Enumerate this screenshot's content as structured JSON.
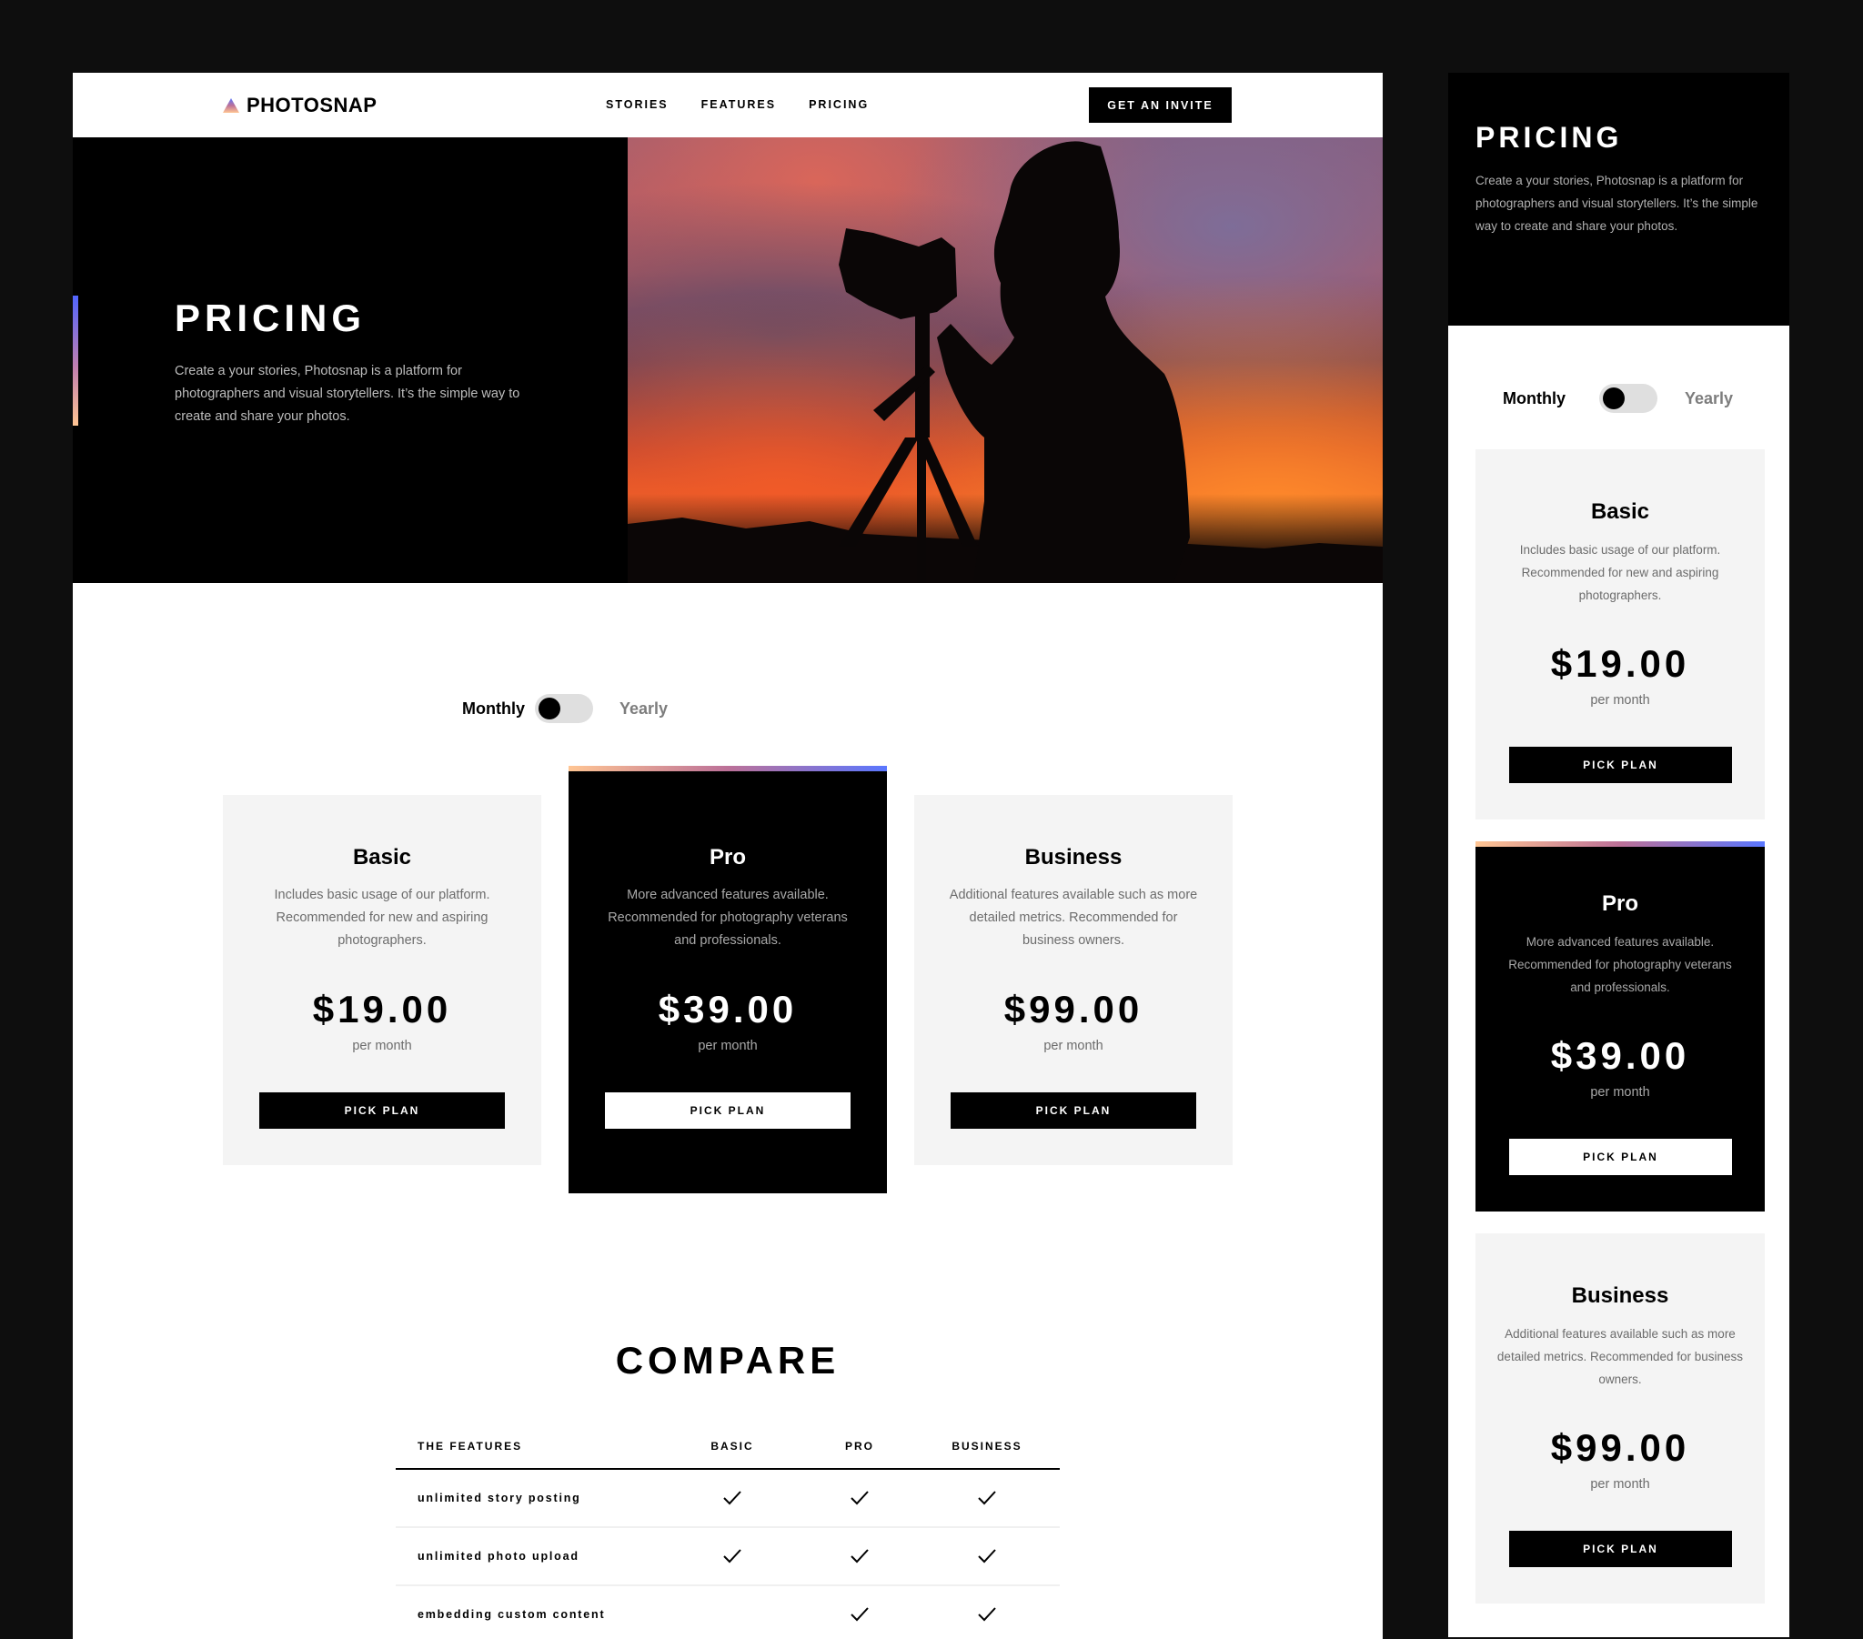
{
  "brand": {
    "name": "PHOTOSNAP",
    "logo_icon": "triangle-logo-icon"
  },
  "nav": {
    "links": [
      "STORIES",
      "FEATURES",
      "PRICING"
    ],
    "cta": "GET AN INVITE"
  },
  "hero": {
    "title": "PRICING",
    "text": "Create a your stories, Photosnap is a platform for photographers and visual storytellers. It’s the simple way to create and share your photos.",
    "image": "photographer-silhouette-sunset"
  },
  "billing": {
    "monthly": "Monthly",
    "yearly": "Yearly",
    "selected": "Monthly"
  },
  "plans": [
    {
      "name": "Basic",
      "desc": "Includes basic usage of our platform. Recommended for new and aspiring photographers.",
      "price": "$19.00",
      "period": "per month",
      "cta": "PICK PLAN",
      "featured": false
    },
    {
      "name": "Pro",
      "desc": "More advanced features available. Recommended for photography veterans and professionals.",
      "price": "$39.00",
      "period": "per month",
      "cta": "PICK PLAN",
      "featured": true
    },
    {
      "name": "Business",
      "desc": "Additional features available such as more detailed metrics. Recommended for business owners.",
      "price": "$99.00",
      "period": "per month",
      "cta": "PICK PLAN",
      "featured": false
    }
  ],
  "compare": {
    "title": "COMPARE",
    "headers": [
      "THE FEATURES",
      "BASIC",
      "PRO",
      "BUSINESS"
    ],
    "rows": [
      {
        "feature": "unlimited story posting",
        "basic": true,
        "pro": true,
        "business": true
      },
      {
        "feature": "unlimited photo upload",
        "basic": true,
        "pro": true,
        "business": true
      },
      {
        "feature": "embedding custom content",
        "basic": false,
        "pro": true,
        "business": true
      }
    ]
  },
  "colors": {
    "accent_gradient": [
      "#ffc593",
      "#bc7198",
      "#5a77ff"
    ],
    "card_bg": "#f4f4f4",
    "dark": "#000000"
  }
}
